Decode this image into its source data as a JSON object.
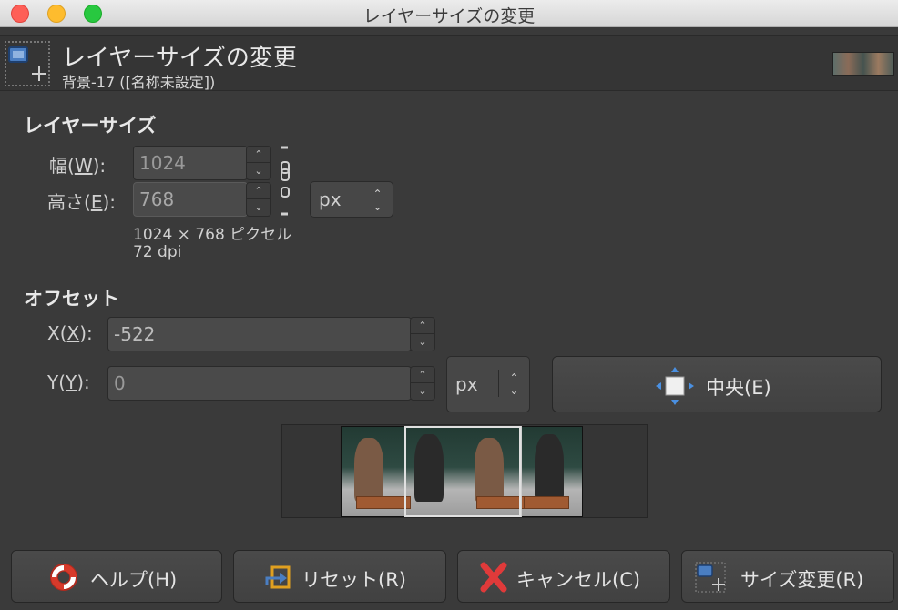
{
  "window": {
    "title": "レイヤーサイズの変更"
  },
  "header": {
    "title": "レイヤーサイズの変更",
    "subtitle": "背景-17 ([名称未設定])"
  },
  "layer_size": {
    "section": "レイヤーサイズ",
    "width_label": "幅(",
    "width_key": "W",
    "width_suffix": "):",
    "width_value": "1024",
    "height_label": "高さ(",
    "height_key": "E",
    "height_suffix": "):",
    "height_value": "768",
    "unit": "px",
    "dims_text": "1024 × 768 ピクセル",
    "dpi_text": "72 dpi"
  },
  "offset": {
    "section": "オフセット",
    "x_label": "X(",
    "x_key": "X",
    "x_suffix": "):",
    "x_value": "-522",
    "y_label": "Y(",
    "y_key": "Y",
    "y_suffix": "):",
    "y_value": "0",
    "unit": "px",
    "center_label": "中央(E)"
  },
  "buttons": {
    "help": "ヘルプ(H)",
    "reset": "リセット(R)",
    "cancel": "キャンセル(C)",
    "resize": "サイズ変更(R)"
  },
  "icons": {
    "help": "lifebuoy-icon",
    "reset": "reset-icon",
    "cancel": "cancel-x-icon",
    "resize": "layer-resize-icon",
    "center": "center-icon",
    "chain": "chain-link-icon"
  }
}
